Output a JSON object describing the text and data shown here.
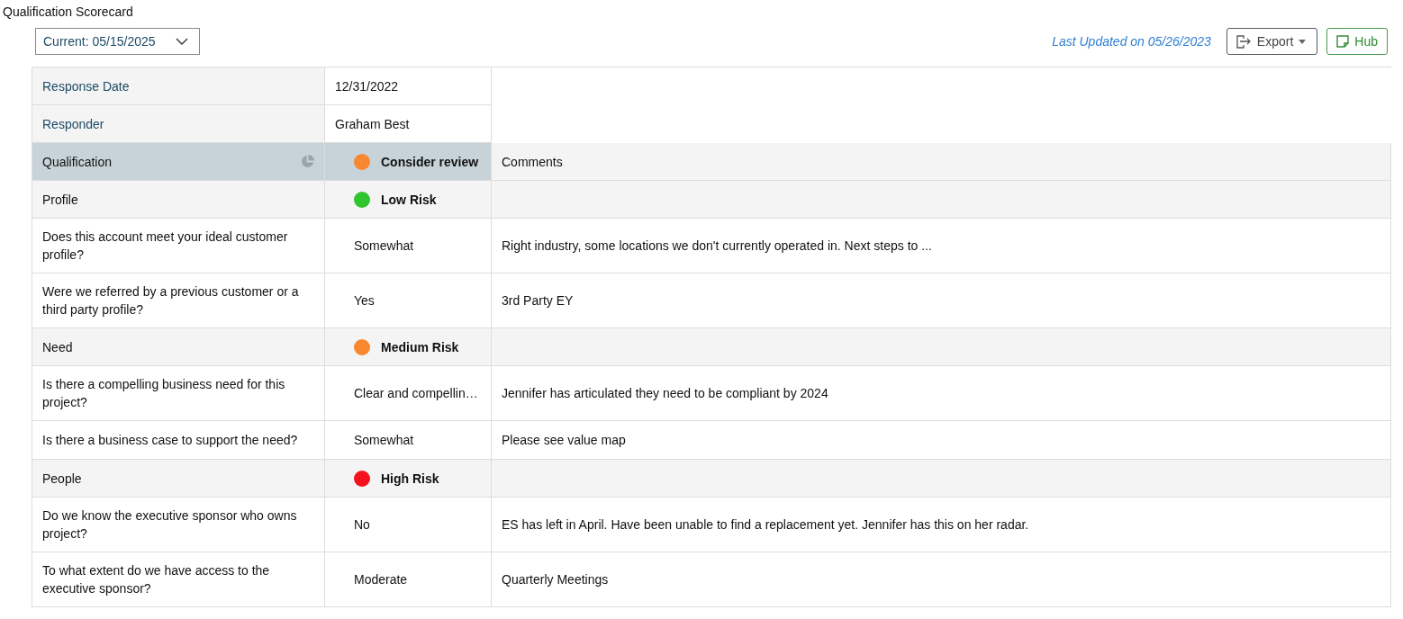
{
  "title": "Qualification Scorecard",
  "version_select": {
    "value": "Current: 05/15/2025"
  },
  "last_updated": "Last Updated on 05/26/2023",
  "buttons": [
    {
      "kind": "export",
      "label": "Export"
    },
    {
      "kind": "hub",
      "label": "Hub"
    }
  ],
  "info": [
    {
      "label": "Response Date",
      "value": "12/31/2022"
    },
    {
      "label": "Responder",
      "value": "Graham Best"
    }
  ],
  "header": {
    "label": "Qualification",
    "status": "Consider review",
    "color": "#f7882f",
    "comments_label": "Comments"
  },
  "rows": [
    {
      "kind": "section",
      "label": "Profile",
      "status": "Low Risk",
      "color": "#2ec52e"
    },
    {
      "kind": "question",
      "question": "Does this account meet your ideal customer profile?",
      "answer": "Somewhat",
      "comment": "Right industry, some locations we don't currently operated in. Next steps to ..."
    },
    {
      "kind": "question",
      "question": "Were we referred by a previous customer or a third party profile?",
      "answer": "Yes",
      "comment": "3rd Party EY"
    },
    {
      "kind": "section",
      "label": "Need",
      "status": "Medium Risk",
      "color": "#f7882f"
    },
    {
      "kind": "question",
      "question": "Is there a compelling business need for this project?",
      "answer": "Clear and compellin…",
      "comment": "Jennifer has articulated they need to be compliant by 2024"
    },
    {
      "kind": "question",
      "question": "Is there a business case to support the need?",
      "answer": "Somewhat",
      "comment": "Please see value map"
    },
    {
      "kind": "section",
      "label": "People",
      "status": "High Risk",
      "color": "#f5121f"
    },
    {
      "kind": "question",
      "question": "Do we know the executive sponsor who owns project?",
      "answer": "No",
      "comment": "ES has left in April. Have been unable to find a replacement yet. Jennifer has this on her radar."
    },
    {
      "kind": "question",
      "question": "To what extent do we have access to the executive sponsor?",
      "answer": "Moderate",
      "comment": "Quarterly Meetings"
    }
  ]
}
